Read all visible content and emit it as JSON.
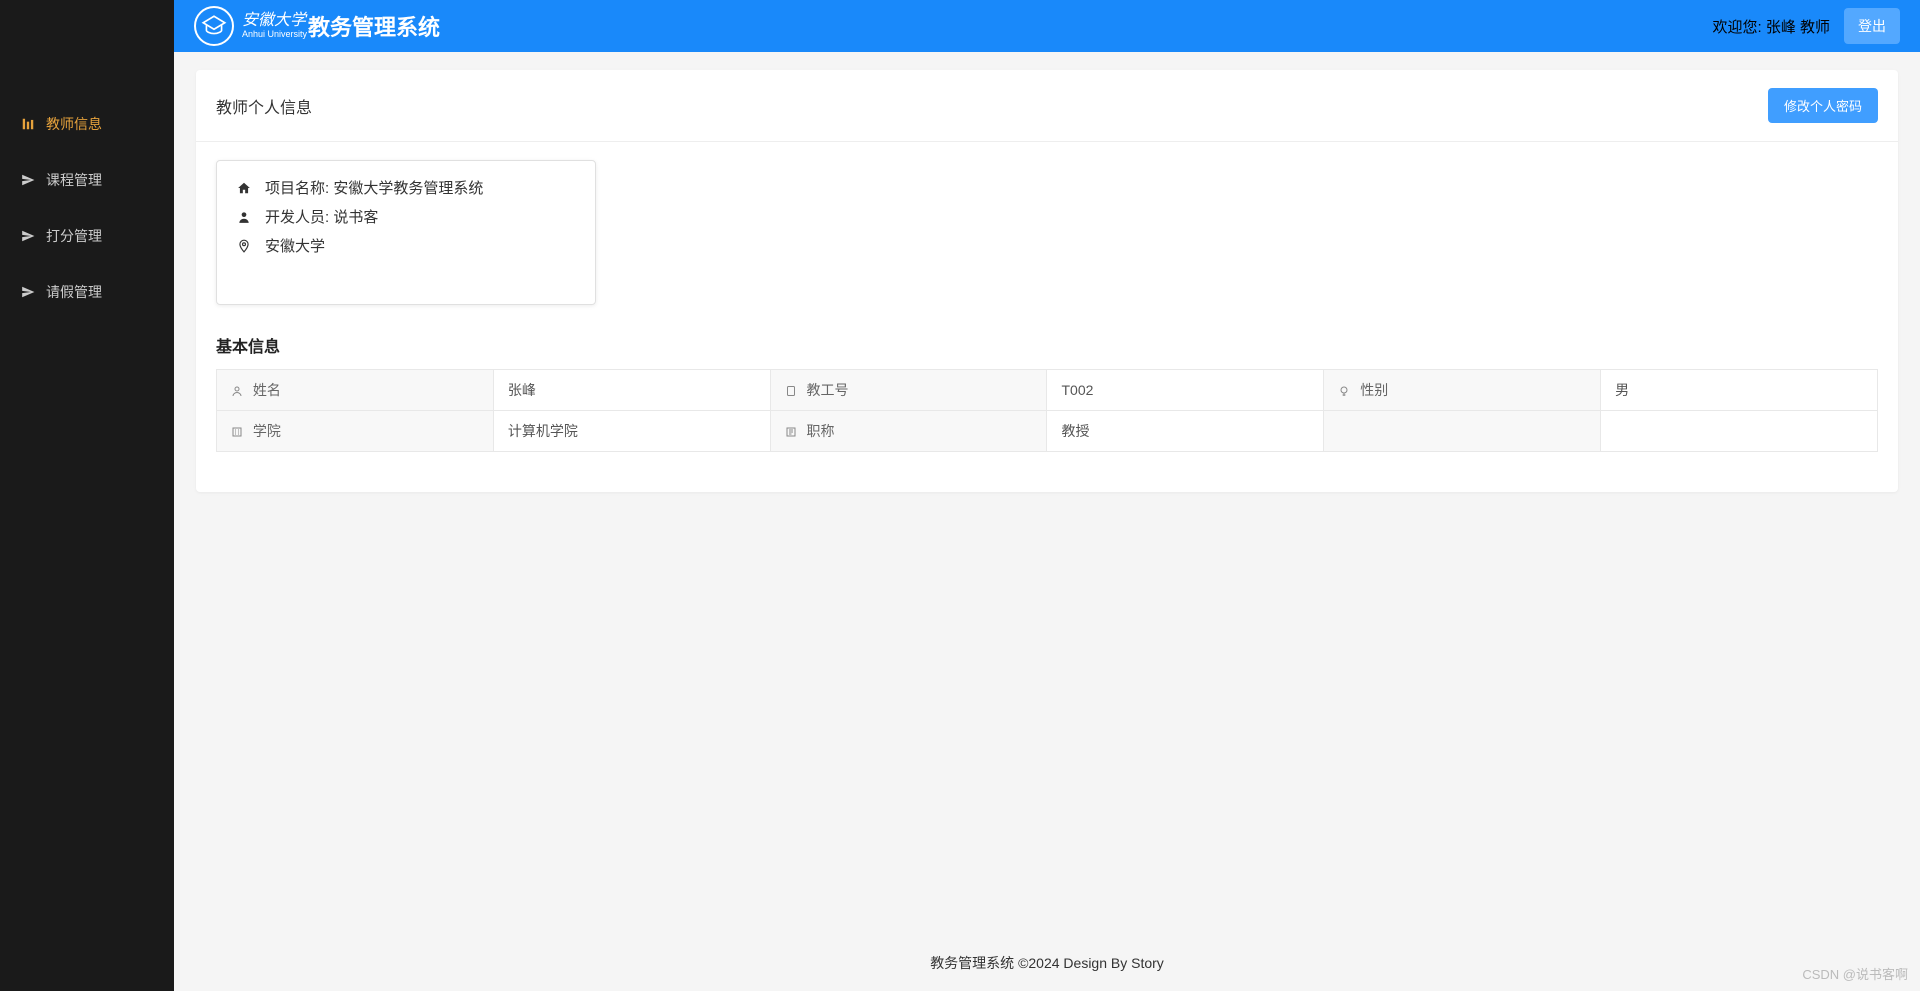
{
  "header": {
    "univ_name": "安徽大学",
    "univ_sub": "Anhui University",
    "system_title": "教务管理系统",
    "welcome_prefix": "欢迎您: ",
    "user_name": "张峰 教师",
    "logout_label": "登出"
  },
  "sidebar": {
    "items": [
      {
        "label": "教师信息",
        "active": true,
        "icon": "profile"
      },
      {
        "label": "课程管理",
        "active": false,
        "icon": "send"
      },
      {
        "label": "打分管理",
        "active": false,
        "icon": "send"
      },
      {
        "label": "请假管理",
        "active": false,
        "icon": "send"
      }
    ]
  },
  "page": {
    "title": "教师个人信息",
    "change_password_label": "修改个人密码"
  },
  "project_info": {
    "name_label": "项目名称: 安徽大学教务管理系统",
    "dev_label": "开发人员: 说书客",
    "location_label": "安徽大学"
  },
  "basic_info": {
    "section_title": "基本信息",
    "rows": [
      {
        "l1": "姓名",
        "v1": "张峰",
        "l2": "教工号",
        "v2": "T002",
        "l3": "性别",
        "v3": "男"
      },
      {
        "l1": "学院",
        "v1": "计算机学院",
        "l2": "职称",
        "v2": "教授",
        "l3": "",
        "v3": ""
      }
    ]
  },
  "footer": {
    "text": "教务管理系统 ©2024 Design By Story"
  },
  "watermark": "CSDN @说书客啊"
}
